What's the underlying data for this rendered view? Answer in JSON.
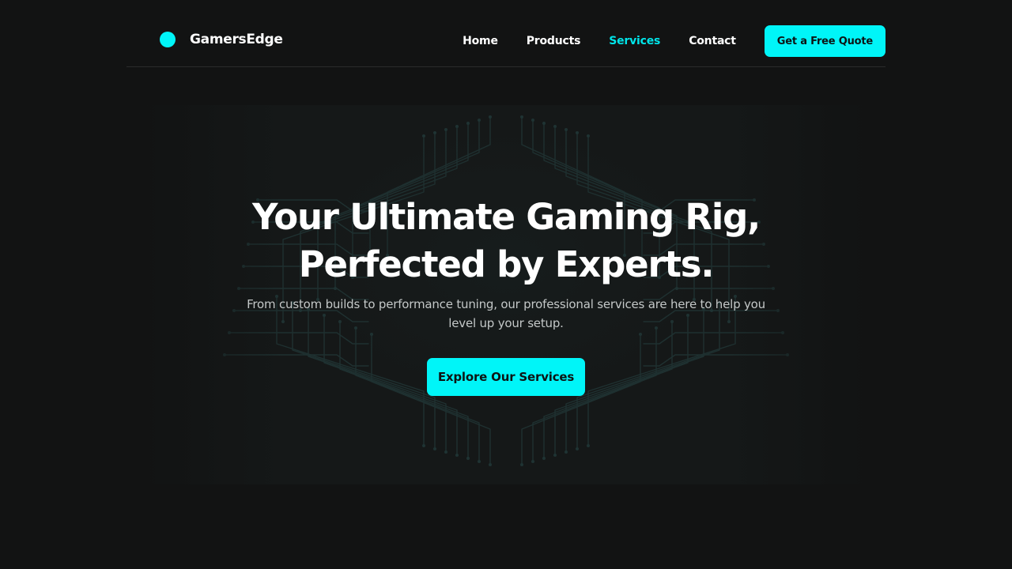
{
  "colors": {
    "accent": "#00f5f8",
    "background": "#121313",
    "text": "#ffffff",
    "muted_text": "#c4c8c8"
  },
  "brand": {
    "name": "GamersEdge",
    "logo_icon": "circle-dot-icon"
  },
  "nav": {
    "items": [
      {
        "label": "Home",
        "active": false
      },
      {
        "label": "Products",
        "active": false
      },
      {
        "label": "Services",
        "active": true
      },
      {
        "label": "Contact",
        "active": false
      }
    ],
    "cta_label": "Get a Free Quote"
  },
  "hero": {
    "title_line1": "Your Ultimate Gaming Rig,",
    "title_line2": "Perfected by Experts.",
    "subtitle": "From custom builds to performance tuning, our professional services are here to help you level up your setup.",
    "cta_label": "Explore Our Services",
    "background_icon": "circuit-board-pattern"
  }
}
